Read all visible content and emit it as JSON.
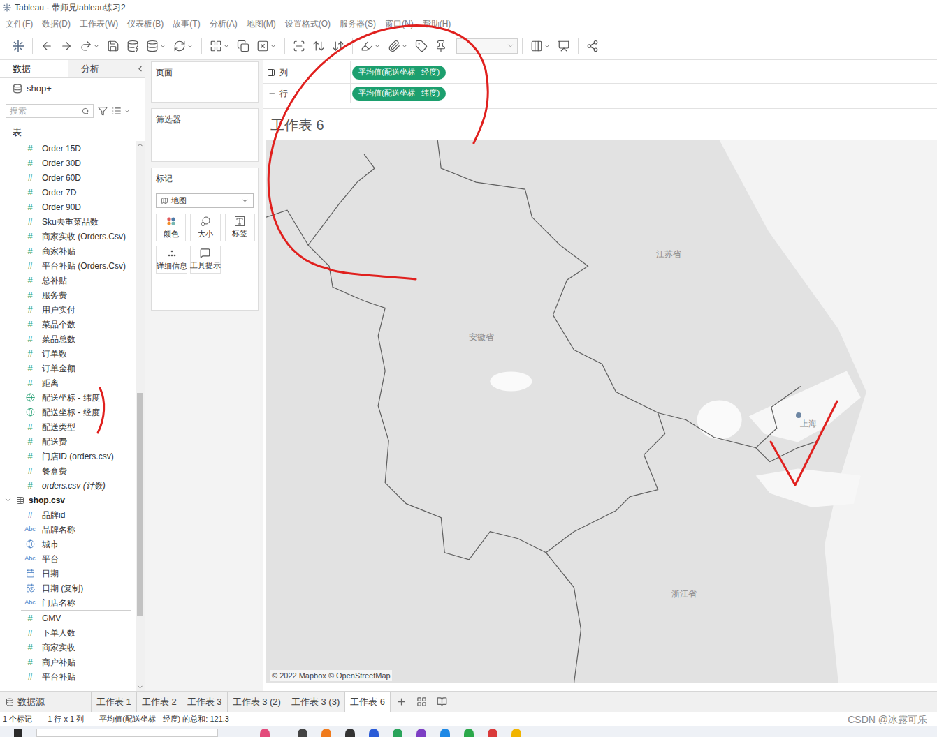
{
  "window": {
    "title": "Tableau - 带师兄tableau练习2"
  },
  "menu": [
    "文件(F)",
    "数据(D)",
    "工作表(W)",
    "仪表板(B)",
    "故事(T)",
    "分析(A)",
    "地图(M)",
    "设置格式(O)",
    "服务器(S)",
    "窗口(N)",
    "帮助(H)"
  ],
  "left_panel": {
    "tabs": [
      {
        "label": "数据",
        "selected": true
      },
      {
        "label": "分析",
        "selected": false
      }
    ],
    "datasource": "shop+",
    "search": {
      "placeholder": "搜索"
    },
    "section_label": "表",
    "fields": [
      {
        "name": "Order 15D",
        "kind": "number",
        "role": "measure",
        "glyph": "#"
      },
      {
        "name": "Order 30D",
        "kind": "number",
        "role": "measure",
        "glyph": "#"
      },
      {
        "name": "Order 60D",
        "kind": "number",
        "role": "measure",
        "glyph": "#"
      },
      {
        "name": "Order 7D",
        "kind": "number",
        "role": "measure",
        "glyph": "#"
      },
      {
        "name": "Order 90D",
        "kind": "number",
        "role": "measure",
        "glyph": "#"
      },
      {
        "name": "Sku去重菜品数",
        "kind": "number",
        "role": "measure",
        "glyph": "#"
      },
      {
        "name": "商家实收 (Orders.Csv)",
        "kind": "number",
        "role": "measure",
        "glyph": "#"
      },
      {
        "name": "商家补贴",
        "kind": "number",
        "role": "measure",
        "glyph": "#"
      },
      {
        "name": "平台补贴 (Orders.Csv)",
        "kind": "number",
        "role": "measure",
        "glyph": "#"
      },
      {
        "name": "总补贴",
        "kind": "number",
        "role": "measure",
        "glyph": "#"
      },
      {
        "name": "服务费",
        "kind": "number",
        "role": "measure",
        "glyph": "#"
      },
      {
        "name": "用户实付",
        "kind": "number",
        "role": "measure",
        "glyph": "#"
      },
      {
        "name": "菜品个数",
        "kind": "number",
        "role": "measure",
        "glyph": "#"
      },
      {
        "name": "菜品总数",
        "kind": "number",
        "role": "measure",
        "glyph": "#"
      },
      {
        "name": "订单数",
        "kind": "number",
        "role": "measure",
        "glyph": "#"
      },
      {
        "name": "订单金额",
        "kind": "number",
        "role": "measure",
        "glyph": "#"
      },
      {
        "name": "距离",
        "kind": "number",
        "role": "measure",
        "glyph": "#"
      },
      {
        "name": "配送坐标 - 纬度",
        "kind": "geo",
        "role": "measure"
      },
      {
        "name": "配送坐标 - 经度",
        "kind": "geo",
        "role": "measure"
      },
      {
        "name": "配送类型",
        "kind": "number",
        "role": "measure",
        "glyph": "#"
      },
      {
        "name": "配送费",
        "kind": "number",
        "role": "measure",
        "glyph": "#"
      },
      {
        "name": "门店ID (orders.csv)",
        "kind": "number",
        "role": "measure",
        "glyph": "#"
      },
      {
        "name": "餐盒费",
        "kind": "number",
        "role": "measure",
        "glyph": "#"
      },
      {
        "name": "orders.csv (计数)",
        "kind": "count",
        "role": "measure",
        "glyph": "#"
      }
    ],
    "table": {
      "name": "shop.csv",
      "expanded": true,
      "fields": [
        {
          "name": "品牌id",
          "kind": "number",
          "role": "dimension",
          "glyph": "#"
        },
        {
          "name": "品牌名称",
          "kind": "string",
          "role": "dimension",
          "glyph": "Abc"
        },
        {
          "name": "城市",
          "kind": "geo",
          "role": "dimension"
        },
        {
          "name": "平台",
          "kind": "string",
          "role": "dimension",
          "glyph": "Abc"
        },
        {
          "name": "日期",
          "kind": "date",
          "role": "dimension"
        },
        {
          "name": "日期 (复制)",
          "kind": "datetime",
          "role": "dimension"
        },
        {
          "name": "门店名称",
          "kind": "string",
          "role": "dimension",
          "glyph": "Abc"
        },
        {
          "name": "GMV",
          "kind": "number",
          "role": "measure",
          "glyph": "#"
        },
        {
          "name": "下单人数",
          "kind": "number",
          "role": "measure",
          "glyph": "#"
        },
        {
          "name": "商家实收",
          "kind": "number",
          "role": "measure",
          "glyph": "#"
        },
        {
          "name": "商户补贴",
          "kind": "number",
          "role": "measure",
          "glyph": "#"
        },
        {
          "name": "平台补贴",
          "kind": "number",
          "role": "measure",
          "glyph": "#"
        }
      ]
    }
  },
  "cards": {
    "pages": "页面",
    "filters": "筛选器",
    "marks": {
      "title": "标记",
      "type": "地图",
      "buttons": [
        "颜色",
        "大小",
        "标签",
        "详细信息",
        "工具提示"
      ]
    }
  },
  "shelves": [
    {
      "label": "列",
      "pills": [
        "平均值(配送坐标 - 经度)"
      ]
    },
    {
      "label": "行",
      "pills": [
        "平均值(配送坐标 - 纬度)"
      ]
    }
  ],
  "view": {
    "title": "工作表 6",
    "map": {
      "labels": [
        "江苏省",
        "安徽省",
        "上海",
        "浙江省"
      ],
      "attribution": "© 2022 Mapbox © OpenStreetMap",
      "points": [
        {
          "color": "#6d86a3"
        }
      ]
    }
  },
  "sheet_tabs": [
    {
      "label": "数据源",
      "selected": false,
      "kind": "source"
    },
    {
      "label": "工作表 1",
      "selected": false,
      "kind": "sheet"
    },
    {
      "label": "工作表 2",
      "selected": false,
      "kind": "sheet"
    },
    {
      "label": "工作表 3",
      "selected": false,
      "kind": "sheet"
    },
    {
      "label": "工作表 3 (2)",
      "selected": false,
      "kind": "sheet"
    },
    {
      "label": "工作表 3 (3)",
      "selected": false,
      "kind": "sheet"
    },
    {
      "label": "工作表 6",
      "selected": true,
      "kind": "sheet"
    }
  ],
  "status_bar": [
    "1 个标记",
    "1 行 x 1 列",
    "平均值(配送坐标 - 经度) 的总和: 121.3"
  ],
  "watermark": "CSDN @冰露可乐"
}
